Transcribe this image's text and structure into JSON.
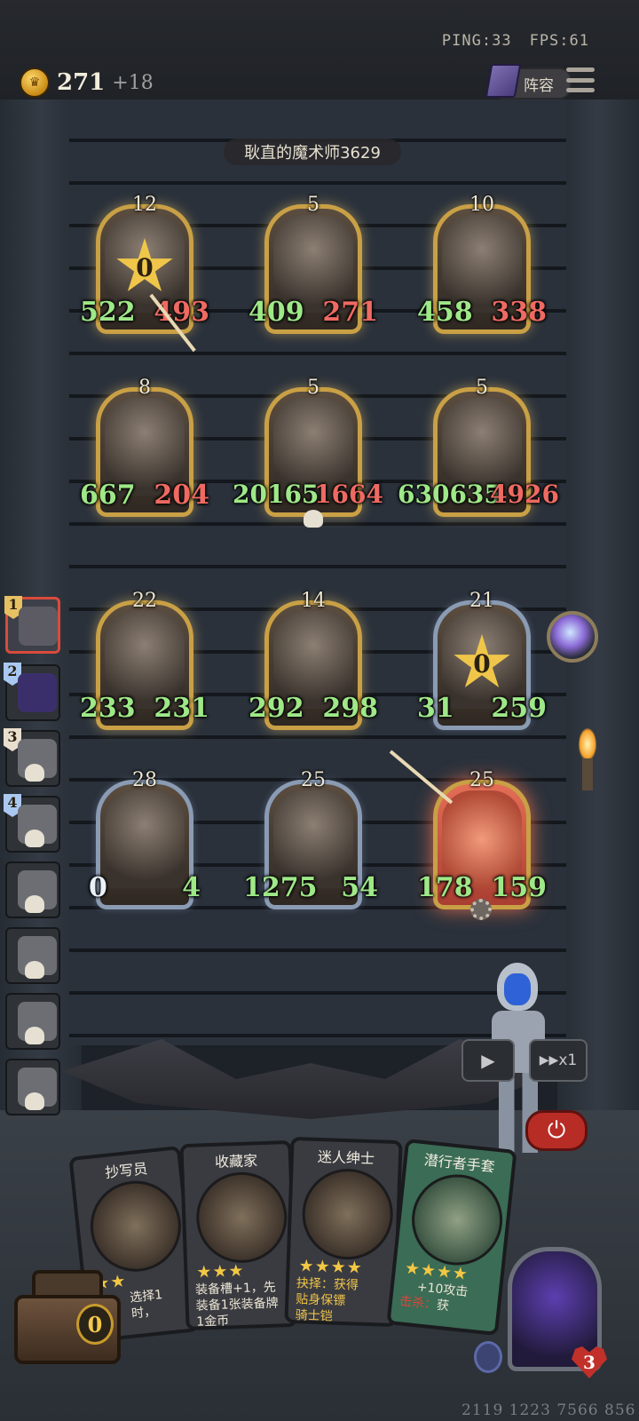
{
  "status": {
    "ping": "PING:33",
    "fps": "FPS:61"
  },
  "resources": {
    "gold": "271",
    "gold_income": "+18"
  },
  "menu": {
    "lineup_label": "阵容"
  },
  "opponent": {
    "name": "耿直的魔术师3629"
  },
  "board": {
    "units": [
      {
        "level": "12",
        "atk": "522",
        "hp": "493",
        "badge": "0"
      },
      {
        "level": "5",
        "atk": "409",
        "hp": "271"
      },
      {
        "level": "10",
        "atk": "458",
        "hp": "338"
      },
      {
        "level": "8",
        "atk": "667",
        "hp": "204"
      },
      {
        "level": "5",
        "atk": "20165",
        "hp": "1664"
      },
      {
        "level": "5",
        "atk": "630635",
        "hp": "4926"
      },
      {
        "level": "22",
        "atk": "233",
        "hp": "231"
      },
      {
        "level": "14",
        "atk": "292",
        "hp": "298"
      },
      {
        "level": "21",
        "atk": "31",
        "hp": "259",
        "badge": "0"
      },
      {
        "level": "28",
        "atk": "0",
        "hp": "4"
      },
      {
        "level": "25",
        "atk": "1275",
        "hp": "54"
      },
      {
        "level": "25",
        "atk": "178",
        "hp": "159"
      }
    ]
  },
  "roster": {
    "ranks": [
      "1",
      "2",
      "3",
      "4"
    ]
  },
  "controls": {
    "speed_label": "x1"
  },
  "shop": {
    "cards": [
      {
        "title": "抄写员",
        "stars": "★★",
        "desc_1": "选择1",
        "desc_2": "时，"
      },
      {
        "title": "收藏家",
        "stars": "★★★",
        "desc_1": "装备槽+1，先",
        "desc_2": "装备1张装备牌",
        "desc_3": "1金币"
      },
      {
        "title": "迷人绅士",
        "stars": "★★★★",
        "desc_1": "抉择：获得",
        "desc_2": "贴身保镖",
        "desc_3": "骑士铠"
      },
      {
        "title": "潜行者手套",
        "stars": "★★★★",
        "desc_1": "+10攻击",
        "desc_2_label": "击杀：",
        "desc_2": "获"
      }
    ]
  },
  "chest": {
    "count": "0"
  },
  "player": {
    "lives": "3"
  },
  "footer": {
    "id": "2119 1223 7566 856"
  },
  "colors": {
    "attack": "#9ee888",
    "health": "#ee6a62",
    "gold": "#f0c64a"
  }
}
